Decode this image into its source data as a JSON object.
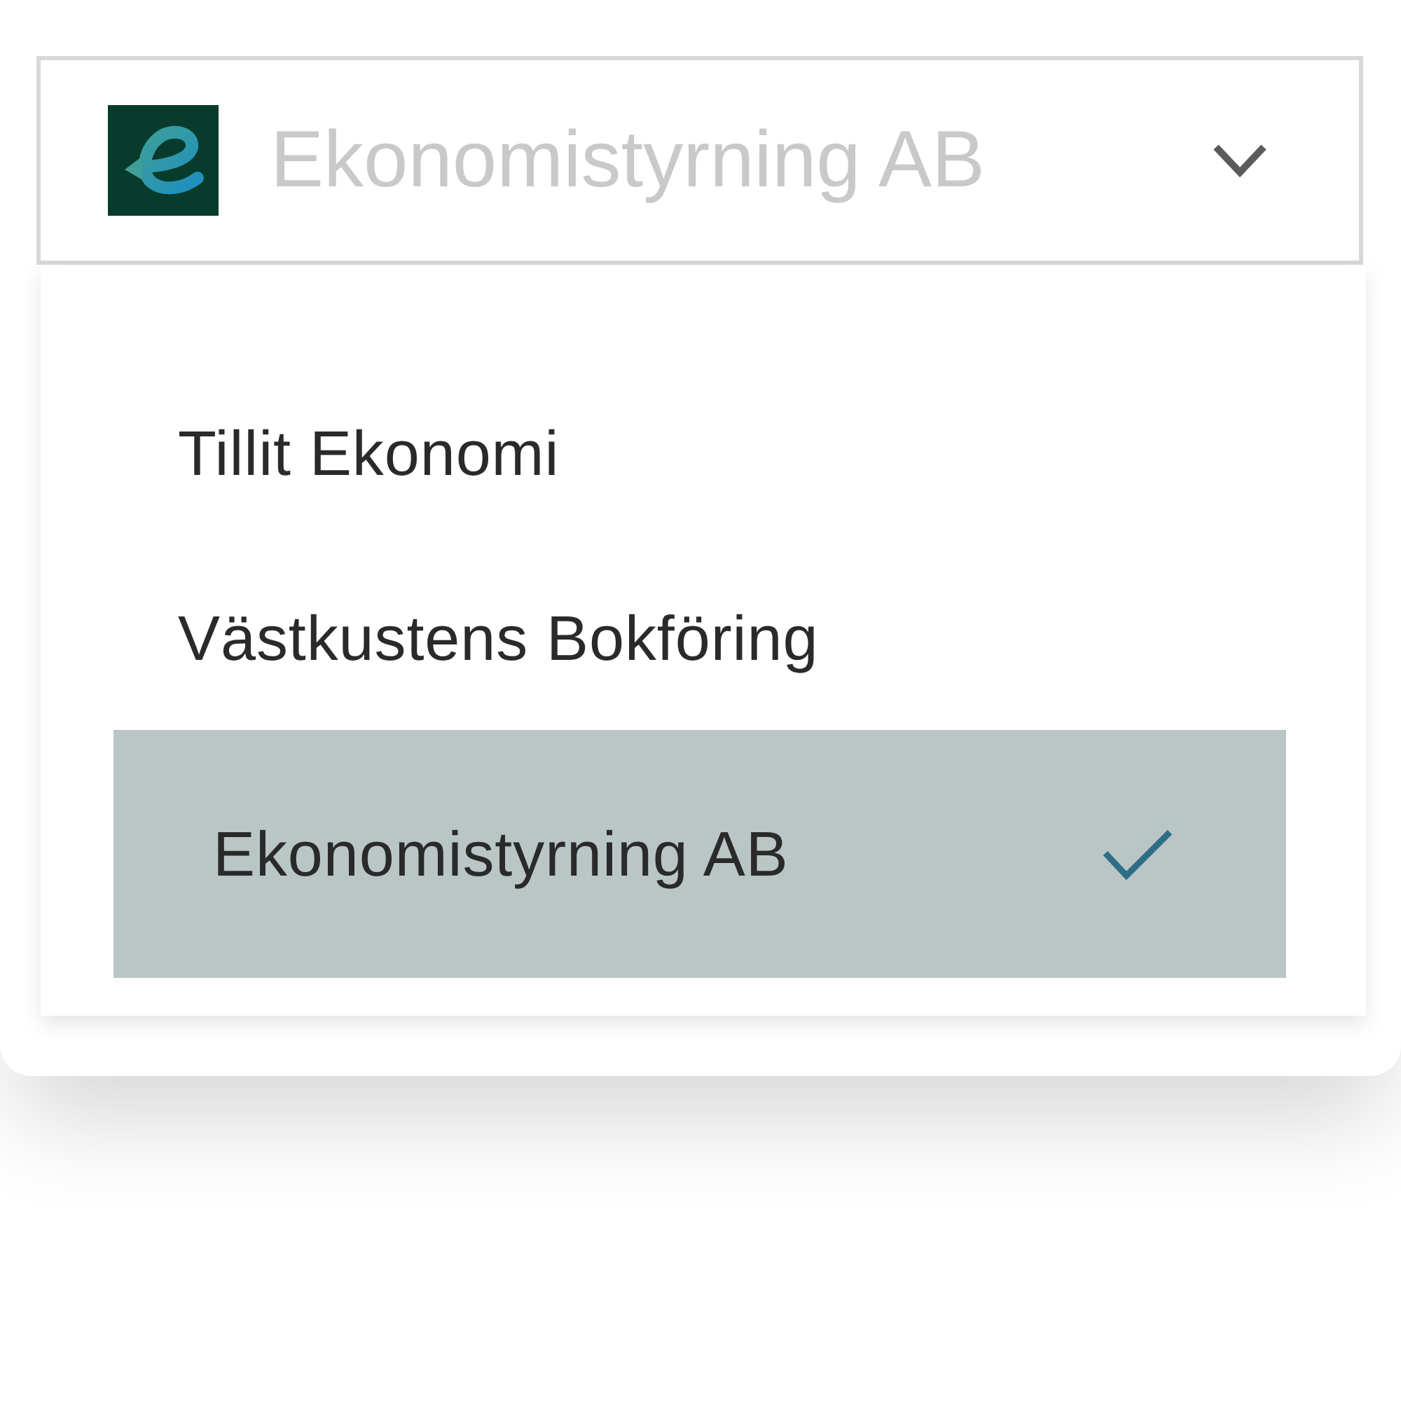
{
  "select": {
    "value": "Ekonomistyrning AB",
    "expanded": true
  },
  "options": [
    {
      "label": "Tillit Ekonomi",
      "selected": false
    },
    {
      "label": "Västkustens Bokföring",
      "selected": false
    },
    {
      "label": "Ekonomistyrning AB",
      "selected": true
    }
  ]
}
